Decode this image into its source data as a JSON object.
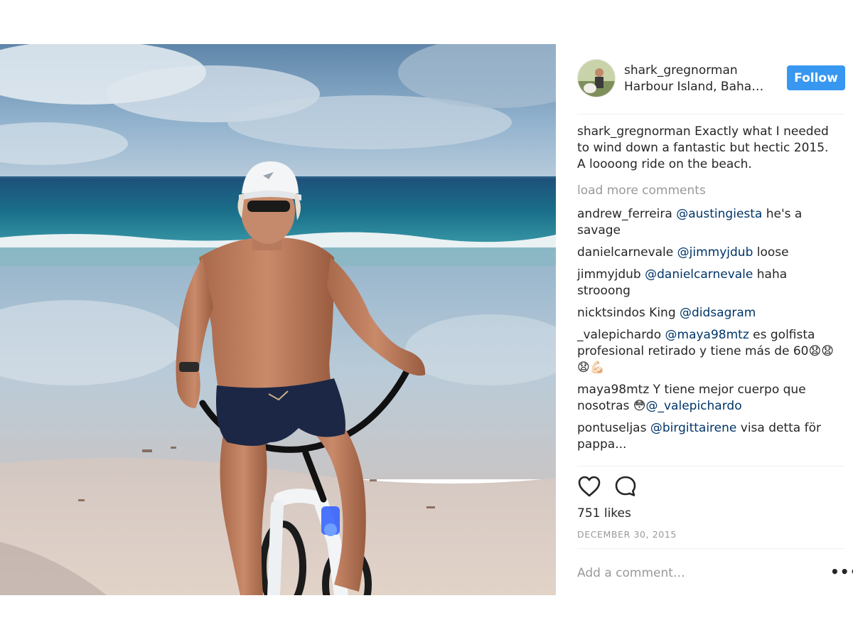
{
  "post": {
    "username": "shark_gregnorman",
    "location": "Harbour Island, Baha…",
    "follow_label": "Follow"
  },
  "caption": {
    "username": "shark_gregnorman",
    "text": "Exactly what I needed to wind down a fantastic but hectic 2015. A loooong ride on the beach."
  },
  "load_more_label": "load more comments",
  "comments": [
    {
      "user": "andrew_ferreira",
      "mention": "@austingiesta",
      "text": "he's a savage"
    },
    {
      "user": "danielcarnevale",
      "mention": "@jimmyjdub",
      "text": "loose"
    },
    {
      "user": "jimmyjdub",
      "mention": "@danielcarnevale",
      "text": "haha strooong"
    },
    {
      "user": "nicktsindos",
      "pre": "King",
      "mention": "@didsagram"
    },
    {
      "user": "_valepichardo",
      "mention": "@maya98mtz",
      "text": "es golfista profesional retirado y tiene más de 60😧😧😧💪🏻"
    },
    {
      "user": "maya98mtz",
      "text": "Y tiene mejor cuerpo que nosotras 😳",
      "mention": "@_valepichardo"
    },
    {
      "user": "pontuseljas",
      "mention": "@birgittairene",
      "text": "visa detta för pappa..."
    }
  ],
  "likes_label": "751 likes",
  "date_label": "DECEMBER 30, 2015",
  "add_comment_placeholder": "Add a comment…",
  "more_label": "•••",
  "icons": {
    "like": "heart-icon",
    "comment": "comment-bubble-icon",
    "more": "more-options-icon"
  },
  "colors": {
    "follow_bg": "#3897f0",
    "mention": "#003569",
    "muted": "#999999",
    "text": "#262626"
  }
}
